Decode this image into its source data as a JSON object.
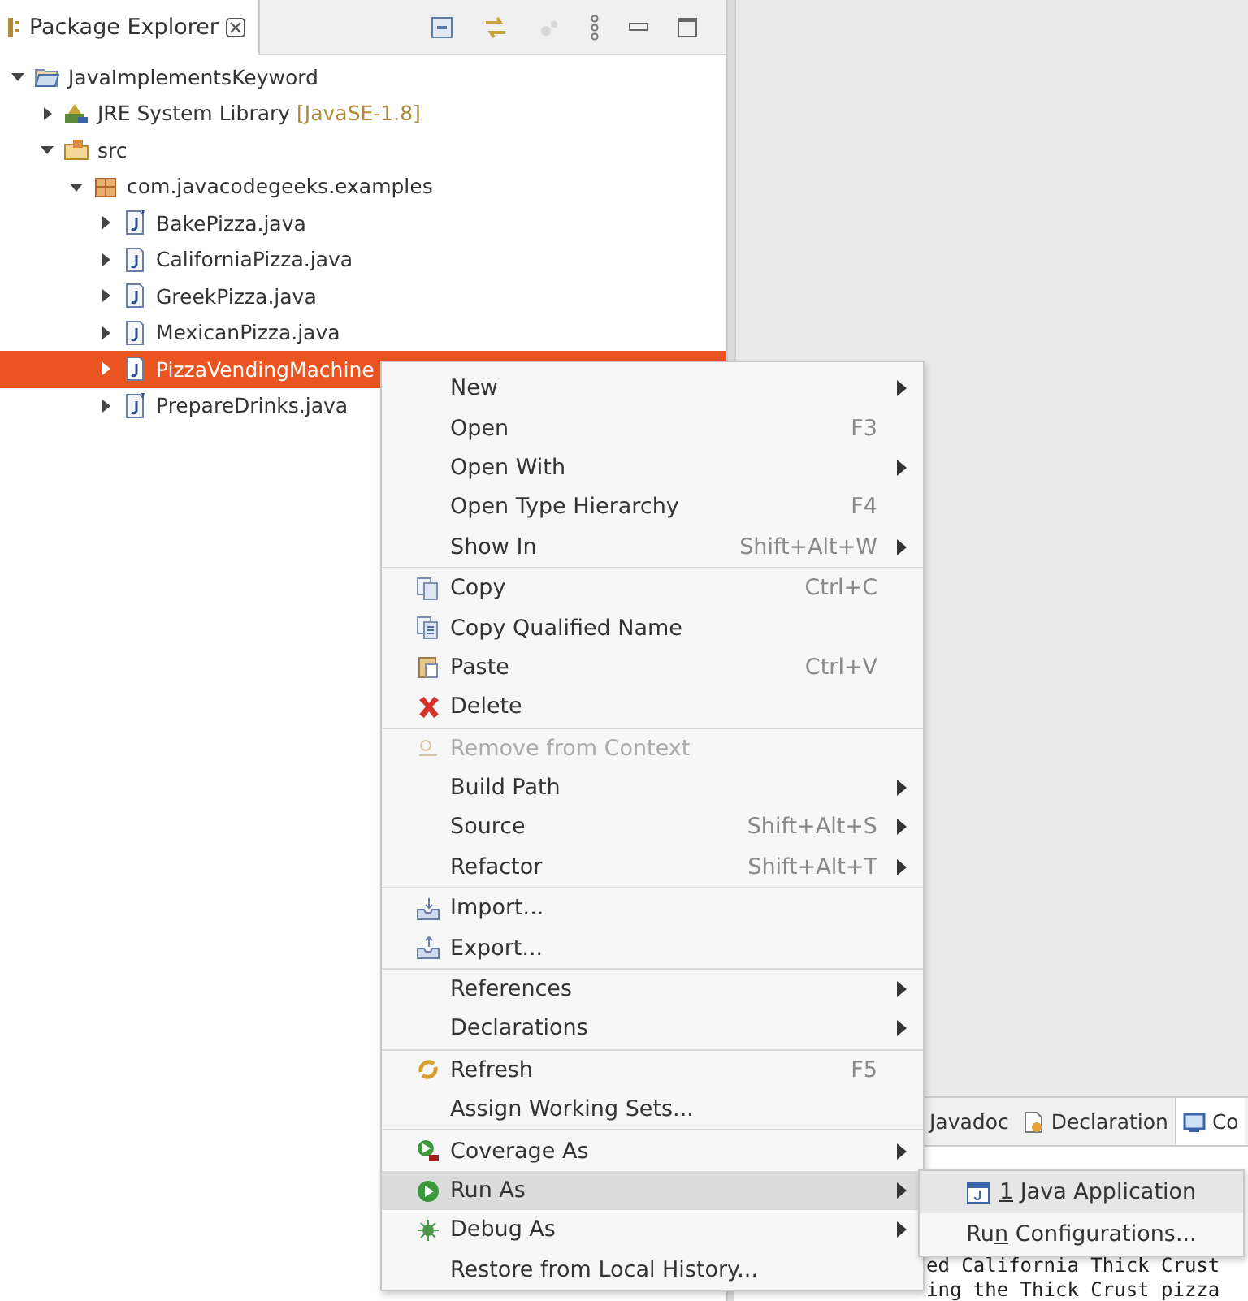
{
  "explorer": {
    "title": "Package Explorer",
    "tree": [
      {
        "label": "JavaImplementsKeyword",
        "kind": "project",
        "expanded": true,
        "selected": false,
        "children": [
          {
            "label": "JRE System Library",
            "decoration": "[JavaSE-1.8]",
            "kind": "library",
            "expanded": false,
            "selected": false
          },
          {
            "label": "src",
            "kind": "source-folder",
            "expanded": true,
            "selected": false,
            "children": [
              {
                "label": "com.javacodegeeks.examples",
                "kind": "package",
                "expanded": true,
                "selected": false,
                "children": [
                  {
                    "label": "BakePizza.java",
                    "kind": "java-abstract",
                    "expanded": false,
                    "selected": false
                  },
                  {
                    "label": "CaliforniaPizza.java",
                    "kind": "java",
                    "expanded": false,
                    "selected": false
                  },
                  {
                    "label": "GreekPizza.java",
                    "kind": "java",
                    "expanded": false,
                    "selected": false
                  },
                  {
                    "label": "MexicanPizza.java",
                    "kind": "java",
                    "expanded": false,
                    "selected": false
                  },
                  {
                    "label": "PizzaVendingMachine",
                    "kind": "java",
                    "expanded": false,
                    "selected": true
                  },
                  {
                    "label": "PrepareDrinks.java",
                    "kind": "java-abstract",
                    "expanded": false,
                    "selected": false
                  }
                ]
              }
            ]
          }
        ]
      }
    ]
  },
  "bottom_panel": {
    "tabs": [
      {
        "label": "Javadoc",
        "kind": "plain",
        "selected": false
      },
      {
        "label": "Declaration",
        "kind": "declaration",
        "selected": false
      },
      {
        "label": "Co",
        "kind": "console",
        "selected": true
      }
    ],
    "console_lines": [
      "ed California Thick Crust",
      "ing the Thick Crust pizza"
    ]
  },
  "context_menu": {
    "groups": [
      [
        {
          "label": "New",
          "kind": "plain",
          "has_submenu": true,
          "disabled": false,
          "selected": false
        },
        {
          "label": "Open",
          "shortcut": "F3",
          "kind": "plain",
          "has_submenu": false,
          "disabled": false,
          "selected": false
        },
        {
          "label": "Open With",
          "kind": "plain",
          "has_submenu": true,
          "disabled": false,
          "selected": false
        },
        {
          "label": "Open Type Hierarchy",
          "shortcut": "F4",
          "kind": "plain",
          "has_submenu": false,
          "disabled": false,
          "selected": false
        },
        {
          "label": "Show In",
          "shortcut": "Shift+Alt+W",
          "kind": "plain",
          "has_submenu": true,
          "disabled": false,
          "selected": false
        }
      ],
      [
        {
          "label": "Copy",
          "shortcut": "Ctrl+C",
          "kind": "copy",
          "has_submenu": false,
          "disabled": false,
          "selected": false
        },
        {
          "label": "Copy Qualified Name",
          "kind": "copy-qualified",
          "has_submenu": false,
          "disabled": false,
          "selected": false
        },
        {
          "label": "Paste",
          "shortcut": "Ctrl+V",
          "kind": "paste",
          "has_submenu": false,
          "disabled": false,
          "selected": false
        },
        {
          "label": "Delete",
          "kind": "delete",
          "has_submenu": false,
          "disabled": false,
          "selected": false
        }
      ],
      [
        {
          "label": "Remove from Context",
          "kind": "remove-context",
          "has_submenu": false,
          "disabled": true,
          "selected": false
        },
        {
          "label": "Build Path",
          "kind": "plain",
          "has_submenu": true,
          "disabled": false,
          "selected": false
        },
        {
          "label": "Source",
          "shortcut": "Shift+Alt+S",
          "kind": "plain",
          "has_submenu": true,
          "disabled": false,
          "selected": false
        },
        {
          "label": "Refactor",
          "shortcut": "Shift+Alt+T",
          "kind": "plain",
          "has_submenu": true,
          "disabled": false,
          "selected": false
        }
      ],
      [
        {
          "label": "Import...",
          "kind": "import",
          "has_submenu": false,
          "disabled": false,
          "selected": false
        },
        {
          "label": "Export...",
          "kind": "export",
          "has_submenu": false,
          "disabled": false,
          "selected": false
        }
      ],
      [
        {
          "label": "References",
          "kind": "plain",
          "has_submenu": true,
          "disabled": false,
          "selected": false
        },
        {
          "label": "Declarations",
          "kind": "plain",
          "has_submenu": true,
          "disabled": false,
          "selected": false
        }
      ],
      [
        {
          "label": "Refresh",
          "shortcut": "F5",
          "kind": "refresh",
          "has_submenu": false,
          "disabled": false,
          "selected": false
        },
        {
          "label": "Assign Working Sets...",
          "kind": "plain",
          "has_submenu": false,
          "disabled": false,
          "selected": false
        }
      ],
      [
        {
          "label": "Coverage As",
          "kind": "coverage",
          "has_submenu": true,
          "disabled": false,
          "selected": false
        },
        {
          "label": "Run As",
          "kind": "run",
          "has_submenu": true,
          "disabled": false,
          "selected": true
        },
        {
          "label": "Debug As",
          "kind": "debug",
          "has_submenu": true,
          "disabled": false,
          "selected": false
        },
        {
          "label": "Restore from Local History...",
          "kind": "plain",
          "has_submenu": false,
          "disabled": false,
          "selected": false
        }
      ]
    ]
  },
  "submenu": {
    "items": [
      {
        "mnemonic": "1",
        "after": " Java Application",
        "kind": "java-app",
        "selected": true
      },
      {
        "before": "Ru",
        "mnemonic": "n",
        "after": " Configurations...",
        "kind": "plain",
        "selected": false
      }
    ]
  }
}
